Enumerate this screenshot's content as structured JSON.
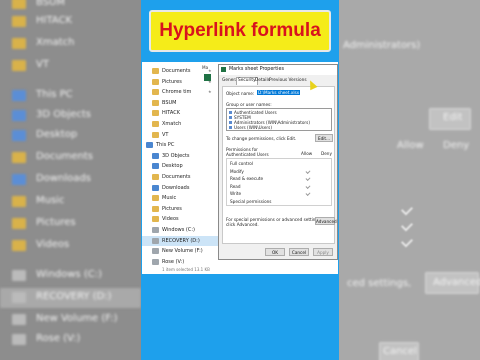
{
  "title_banner": "Hyperlink formula",
  "background_left": {
    "items": [
      {
        "label": "BSUM",
        "icon": "folder"
      },
      {
        "label": "HITACK",
        "icon": "folder"
      },
      {
        "label": "Xmatch",
        "icon": "folder"
      },
      {
        "label": "VT",
        "icon": "folder"
      },
      {
        "label": "This PC",
        "icon": "pc"
      },
      {
        "label": "3D Objects",
        "icon": "folder-blue"
      },
      {
        "label": "Desktop",
        "icon": "folder-blue"
      },
      {
        "label": "Documents",
        "icon": "folder"
      },
      {
        "label": "Downloads",
        "icon": "folder-blue"
      },
      {
        "label": "Music",
        "icon": "folder"
      },
      {
        "label": "Pictures",
        "icon": "folder"
      },
      {
        "label": "Videos",
        "icon": "folder"
      },
      {
        "label": "Windows (C:)",
        "icon": "drive"
      },
      {
        "label": "RECOVERY (D:)",
        "icon": "drive"
      },
      {
        "label": "New Volume (F:)",
        "icon": "drive"
      },
      {
        "label": "Rose (V:)",
        "icon": "drive"
      }
    ]
  },
  "background_right": {
    "partial_text": "Administrators)",
    "edit_label": "Edit",
    "allow_header": "Allow",
    "deny_header": "Deny",
    "advanced_settings_text": "ced settings,",
    "advanced_label": "Advanced",
    "cancel_label": "Cancel"
  },
  "explorer": {
    "nav_items": [
      {
        "label": "Documents",
        "icon": "folder",
        "pinned": true
      },
      {
        "label": "Pictures",
        "icon": "folder",
        "pinned": true
      },
      {
        "label": "Chrome tim",
        "icon": "folder",
        "pinned": true
      },
      {
        "label": "BSUM",
        "icon": "folder",
        "pinned": false
      },
      {
        "label": "HITACK",
        "icon": "folder",
        "pinned": false
      },
      {
        "label": "Xmatch",
        "icon": "folder",
        "pinned": false
      },
      {
        "label": "VT",
        "icon": "folder",
        "pinned": false
      },
      {
        "label": "This PC",
        "icon": "pc",
        "pinned": false
      },
      {
        "label": "3D Objects",
        "icon": "folder-blue",
        "pinned": false
      },
      {
        "label": "Desktop",
        "icon": "folder-blue",
        "pinned": false
      },
      {
        "label": "Documents",
        "icon": "folder",
        "pinned": false
      },
      {
        "label": "Downloads",
        "icon": "folder-blue",
        "pinned": false
      },
      {
        "label": "Music",
        "icon": "folder",
        "pinned": false
      },
      {
        "label": "Pictures",
        "icon": "folder",
        "pinned": false
      },
      {
        "label": "Videos",
        "icon": "folder",
        "pinned": false
      },
      {
        "label": "Windows (C:)",
        "icon": "drive",
        "pinned": false
      },
      {
        "label": "RECOVERY (D:)",
        "icon": "drive",
        "pinned": false,
        "selected": true
      },
      {
        "label": "New Volume (F:)",
        "icon": "drive",
        "pinned": false
      },
      {
        "label": "Rose (V:)",
        "icon": "drive",
        "pinned": false
      }
    ],
    "file_prefix": "Ma",
    "status_text": "1 item selected 13.1 KB"
  },
  "dialog": {
    "title": "Marks sheet Properties",
    "tabs": [
      "General",
      "Security",
      "Details",
      "Previous Versions"
    ],
    "active_tab": "Security",
    "object_name_label": "Object name:",
    "object_name_value": "D:\\Marks sheet.xlsx",
    "group_label": "Group or user names:",
    "groups": [
      "Authenticated Users",
      "SYSTEM",
      "Administrators (WIN\\Administrators)",
      "Users (WIN\\Users)"
    ],
    "change_perm_text": "To change permissions, click Edit.",
    "edit_label": "Edit...",
    "perm_header": "Permissions for Authenticated Users",
    "allow_label": "Allow",
    "deny_label": "Deny",
    "permissions": [
      {
        "name": "Full control",
        "allow": false,
        "deny": false
      },
      {
        "name": "Modify",
        "allow": true,
        "deny": false
      },
      {
        "name": "Read & execute",
        "allow": true,
        "deny": false
      },
      {
        "name": "Read",
        "allow": true,
        "deny": false
      },
      {
        "name": "Write",
        "allow": true,
        "deny": false
      },
      {
        "name": "Special permissions",
        "allow": false,
        "deny": false
      }
    ],
    "special_text_1": "For special permissions or advanced settings,",
    "special_text_2": "click Advanced.",
    "advanced_label": "Advanced",
    "ok_label": "OK",
    "cancel_label": "Cancel",
    "apply_label": "Apply"
  },
  "colors": {
    "banner_bg": "#f5ec19",
    "banner_text": "#d8121e",
    "stage_bg": "#1ea0ec"
  }
}
